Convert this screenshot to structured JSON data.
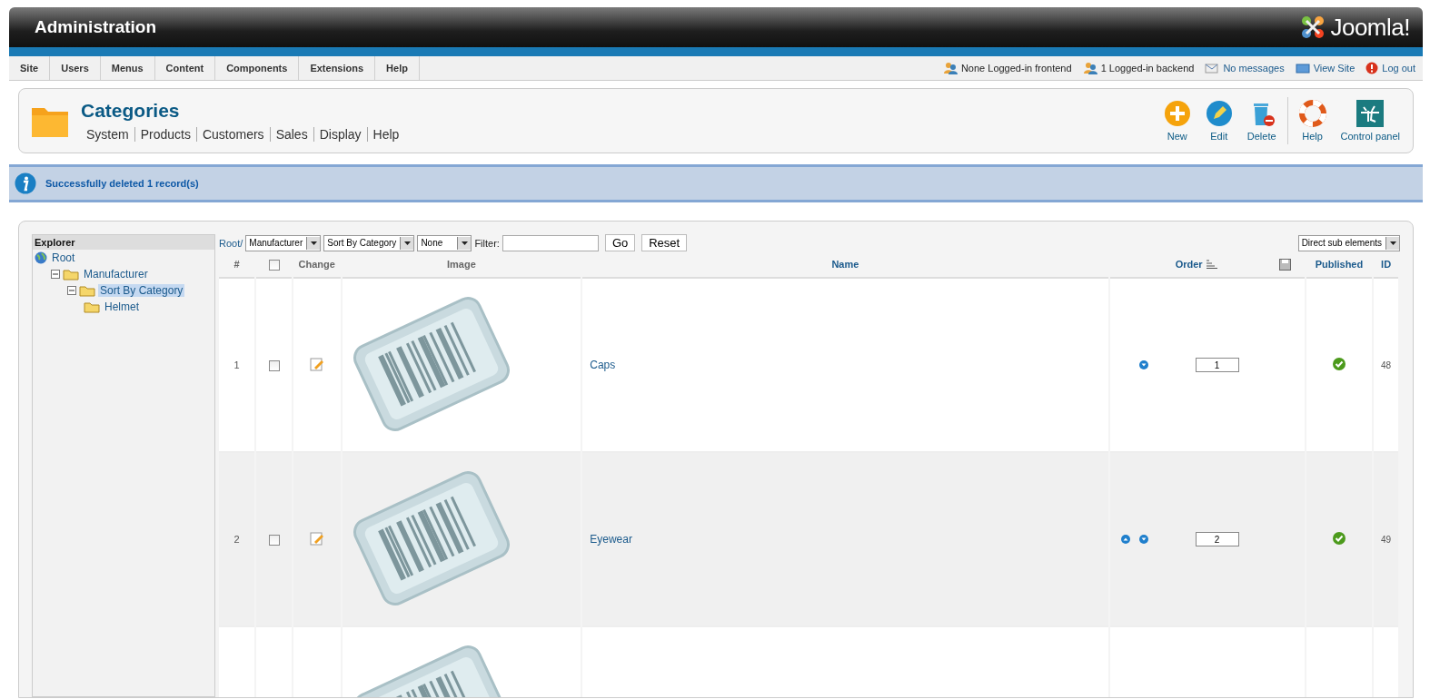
{
  "header": {
    "title": "Administration",
    "logo_text": "Joomla!"
  },
  "menu": [
    "Site",
    "Users",
    "Menus",
    "Content",
    "Components",
    "Extensions",
    "Help"
  ],
  "status": [
    {
      "kind": "users",
      "label": "None Logged-in frontend",
      "link": false
    },
    {
      "kind": "users",
      "label": "1 Logged-in backend",
      "link": false
    },
    {
      "kind": "messages",
      "label": "No messages",
      "link": true
    },
    {
      "kind": "site",
      "label": "View Site",
      "link": true
    },
    {
      "kind": "logout",
      "label": "Log out",
      "link": true
    }
  ],
  "toolbar": {
    "title": "Categories",
    "submenu": [
      "System",
      "Products",
      "Customers",
      "Sales",
      "Display",
      "Help"
    ],
    "buttons": [
      {
        "kind": "new",
        "label": "New"
      },
      {
        "kind": "edit",
        "label": "Edit"
      },
      {
        "kind": "delete",
        "label": "Delete"
      },
      {
        "kind": "help",
        "label": "Help"
      },
      {
        "kind": "control",
        "label": "Control panel"
      }
    ]
  },
  "message": "Successfully deleted 1 record(s)",
  "explorer": {
    "title": "Explorer",
    "tree": [
      {
        "label": "Root",
        "kind": "root",
        "selected": false,
        "children": [
          {
            "label": "Manufacturer",
            "kind": "folder",
            "selected": false,
            "expanded": true,
            "children": [
              {
                "label": "Sort By Category",
                "kind": "folder",
                "selected": true,
                "expanded": true,
                "children": [
                  {
                    "label": "Helmet",
                    "kind": "folder",
                    "selected": false
                  }
                ]
              }
            ]
          }
        ]
      }
    ]
  },
  "filters": {
    "path": "Root/",
    "selects": [
      "Manufacturer",
      "Sort By Category",
      "None"
    ],
    "filter_label": "Filter:",
    "go": "Go",
    "reset": "Reset",
    "scope": "Direct sub elements"
  },
  "table": {
    "select_all_checked": false,
    "columns": [
      "#",
      "Change",
      "Image",
      "Name",
      "Order",
      "Published",
      "ID"
    ],
    "rows": [
      {
        "kind": "full",
        "number": "1",
        "checked": false,
        "name": "Caps",
        "move_up": false,
        "move_down": true,
        "order": "1",
        "published": true,
        "id": "48"
      },
      {
        "kind": "full",
        "number": "2",
        "checked": false,
        "name": "Eyewear",
        "move_up": true,
        "move_down": true,
        "order": "2",
        "published": true,
        "id": "49"
      },
      {
        "kind": "cut_off"
      }
    ]
  }
}
